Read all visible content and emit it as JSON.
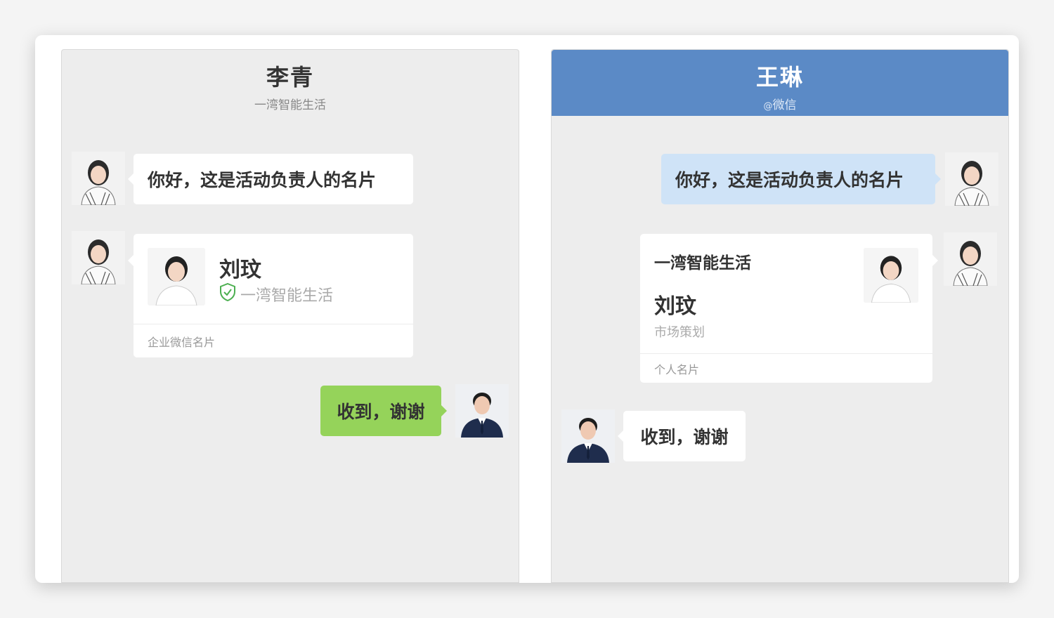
{
  "left_panel": {
    "header": {
      "name": "李青",
      "subtitle": "一湾智能生活"
    },
    "msg1": "你好，这是活动负责人的名片",
    "card": {
      "name": "刘玟",
      "org": "一湾智能生活",
      "footer": "企业微信名片"
    },
    "msg2": "收到，谢谢"
  },
  "right_panel": {
    "header": {
      "name": "王琳",
      "at": "@",
      "subtitle": "微信"
    },
    "msg1": "你好，这是活动负责人的名片",
    "card": {
      "org": "一湾智能生活",
      "name": "刘玟",
      "role": "市场策划",
      "footer": "个人名片"
    },
    "msg2": "收到，谢谢"
  },
  "colors": {
    "panel_bg": "#ededed",
    "header_blue": "#5b8ac6",
    "bubble_green": "#95d35a",
    "bubble_blue": "#cfe3f7",
    "verified_green": "#4caf50"
  },
  "icons": {
    "verified": "shield-check-icon"
  }
}
